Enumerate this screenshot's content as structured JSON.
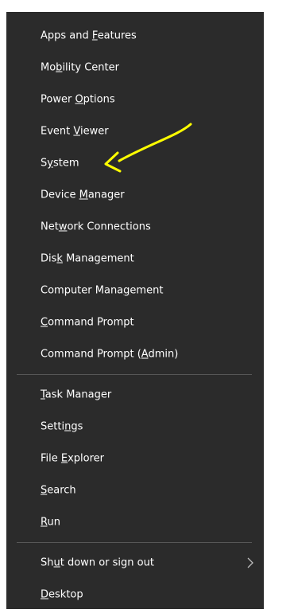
{
  "menu": {
    "groups": [
      {
        "items": [
          {
            "pre": "Apps and ",
            "key": "F",
            "post": "eatures"
          },
          {
            "pre": "Mo",
            "key": "b",
            "post": "ility Center"
          },
          {
            "pre": "Power ",
            "key": "O",
            "post": "ptions"
          },
          {
            "pre": "Event ",
            "key": "V",
            "post": "iewer"
          },
          {
            "pre": "S",
            "key": "y",
            "post": "stem"
          },
          {
            "pre": "Device ",
            "key": "M",
            "post": "anager"
          },
          {
            "pre": "Net",
            "key": "w",
            "post": "ork Connections"
          },
          {
            "pre": "Dis",
            "key": "k",
            "post": " Management"
          },
          {
            "pre": "Computer Mana",
            "key": "g",
            "post": "ement"
          },
          {
            "pre": "",
            "key": "C",
            "post": "ommand Prompt"
          },
          {
            "pre": "Command Prompt (",
            "key": "A",
            "post": "dmin)"
          }
        ]
      },
      {
        "items": [
          {
            "pre": "",
            "key": "T",
            "post": "ask Manager"
          },
          {
            "pre": "Setti",
            "key": "n",
            "post": "gs"
          },
          {
            "pre": "File ",
            "key": "E",
            "post": "xplorer"
          },
          {
            "pre": "",
            "key": "S",
            "post": "earch"
          },
          {
            "pre": "",
            "key": "R",
            "post": "un"
          }
        ]
      },
      {
        "items": [
          {
            "pre": "Sh",
            "key": "u",
            "post": "t down or sign out",
            "submenu": true
          },
          {
            "pre": "",
            "key": "D",
            "post": "esktop"
          }
        ]
      }
    ]
  },
  "colors": {
    "menu_bg": "#2b2b2b",
    "text": "#ffffff",
    "separator": "#575757",
    "annotation_arrow": "#ffff00"
  },
  "icons": {
    "submenu": "chevron-right-icon",
    "annotation": "arrow-annotation"
  }
}
